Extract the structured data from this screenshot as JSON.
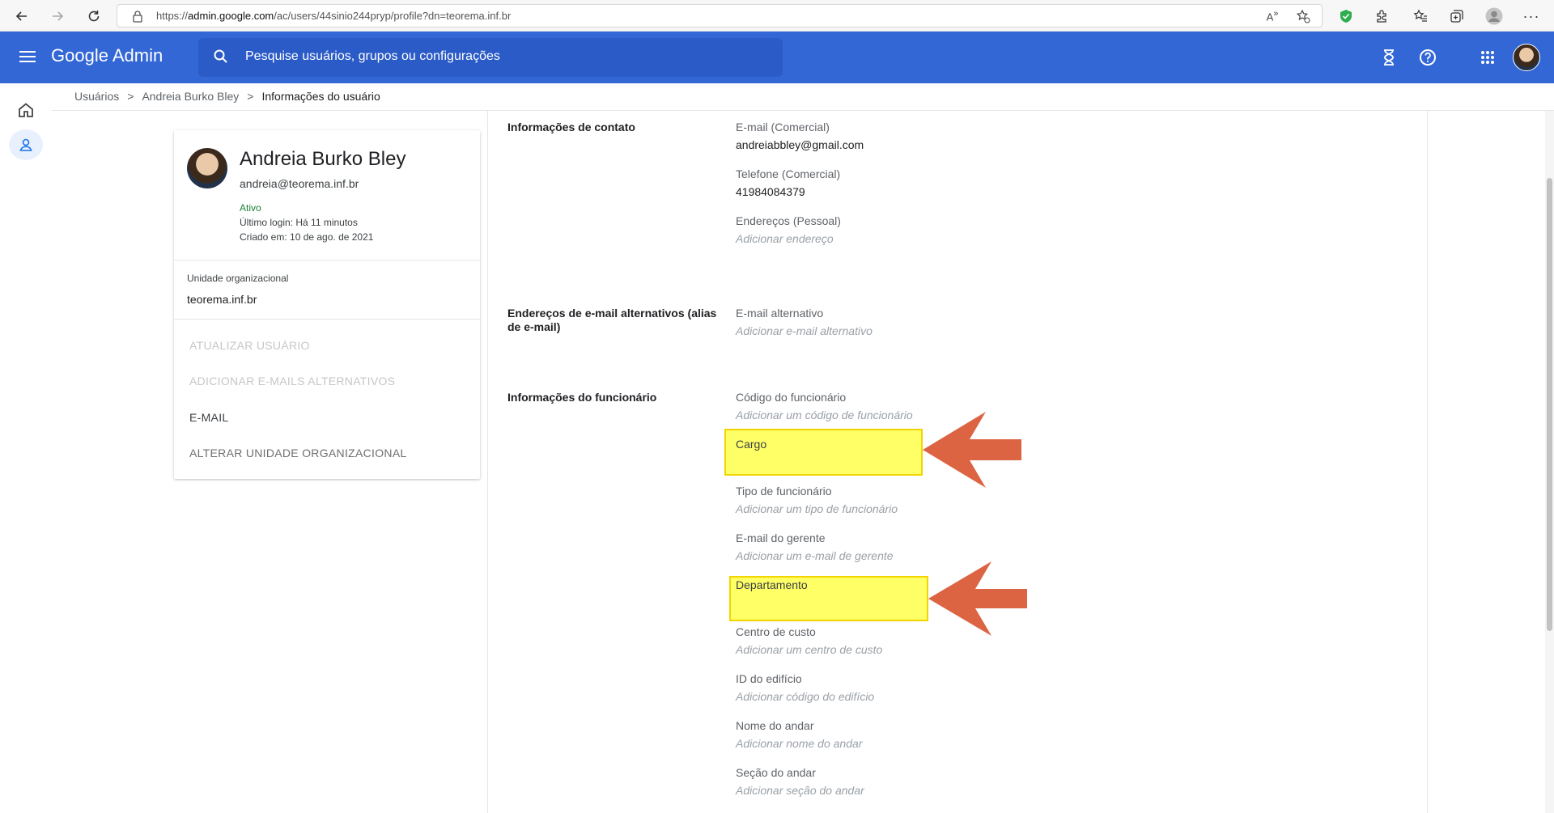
{
  "browser": {
    "url_prefix": "https://",
    "url_domain": "admin.google.com",
    "url_path": "/ac/users/44sinio244pryp/profile?dn=teorema.inf.br"
  },
  "header": {
    "brand": "Google Admin",
    "search_placeholder": "Pesquise usuários, grupos ou configurações"
  },
  "breadcrumb": {
    "items": [
      "Usuários",
      "Andreia Burko Bley",
      "Informações do usuário"
    ],
    "separator": ">"
  },
  "profile": {
    "name": "Andreia Burko Bley",
    "email": "andreia@teorema.inf.br",
    "status": "Ativo",
    "last_login": "Último login: Há 11 minutos",
    "created": "Criado em: 10 de ago. de 2021",
    "ou_label": "Unidade organizacional",
    "ou_value": "teorema.inf.br",
    "actions": [
      {
        "label": "ATUALIZAR USUÁRIO",
        "state": "disabled"
      },
      {
        "label": "ADICIONAR E-MAILS ALTERNATIVOS",
        "state": "disabled"
      },
      {
        "label": "E-MAIL",
        "state": "enabled"
      },
      {
        "label": "ALTERAR UNIDADE ORGANIZACIONAL",
        "state": "grey"
      }
    ]
  },
  "sections": {
    "contact": {
      "title": "Informações de contato",
      "fields": [
        {
          "label": "E-mail (Comercial)",
          "value": "andreiabbley@gmail.com"
        },
        {
          "label": "Telefone (Comercial)",
          "value": "41984084379"
        },
        {
          "label": "Endereços (Pessoal)",
          "placeholder": "Adicionar endereço"
        }
      ]
    },
    "alias": {
      "title": "Endereços de e-mail alternativos (alias de e-mail)",
      "fields": [
        {
          "label": "E-mail alternativo",
          "placeholder": "Adicionar e-mail alternativo"
        }
      ]
    },
    "employee": {
      "title": "Informações do funcionário",
      "fields": [
        {
          "label": "Código do funcionário",
          "placeholder": "Adicionar um código de funcionário"
        },
        {
          "label": "Cargo",
          "placeholder": ""
        },
        {
          "label": "Tipo de funcionário",
          "placeholder": "Adicionar um tipo de funcionário"
        },
        {
          "label": "E-mail do gerente",
          "placeholder": "Adicionar um e-mail de gerente"
        },
        {
          "label": "Departamento",
          "placeholder": ""
        },
        {
          "label": "Centro de custo",
          "placeholder": "Adicionar um centro de custo"
        },
        {
          "label": "ID do edifício",
          "placeholder": "Adicionar código do edifício"
        },
        {
          "label": "Nome do andar",
          "placeholder": "Adicionar nome do andar"
        },
        {
          "label": "Seção do andar",
          "placeholder": "Adicionar seção do andar"
        }
      ]
    }
  },
  "colors": {
    "header_bg": "#3367d6",
    "highlight": "#ffff66",
    "arrow": "#dc6443",
    "status_active": "#188038"
  }
}
